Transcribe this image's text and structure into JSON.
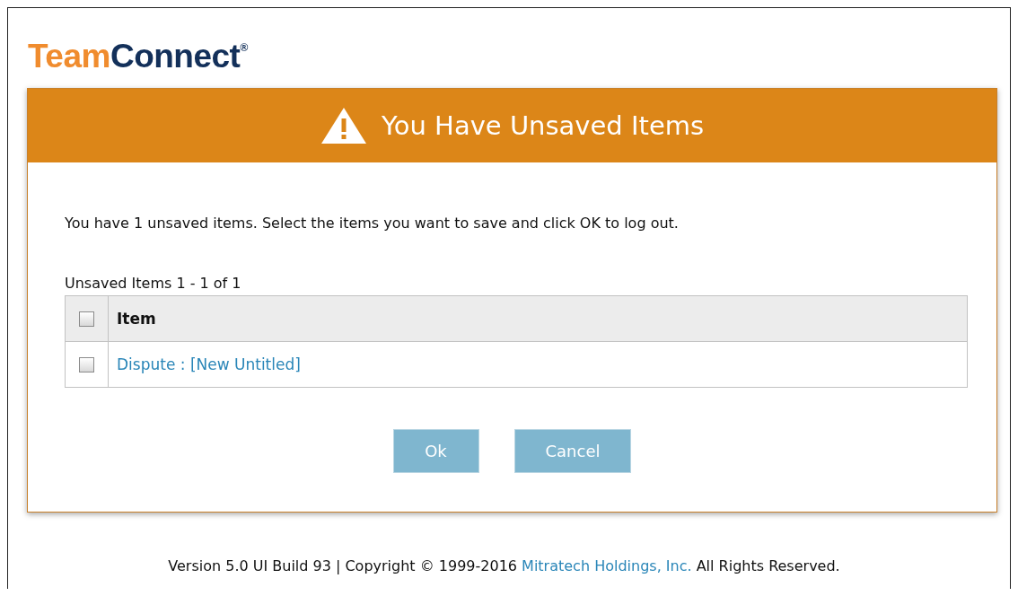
{
  "logo": {
    "first": "Team",
    "second": "Connect",
    "mark": "®"
  },
  "dialog": {
    "title": "You Have Unsaved Items",
    "message": "You have 1 unsaved items. Select the items you want to save and click OK to log out.",
    "table_caption": "Unsaved Items 1 - 1 of 1",
    "header": {
      "label": "Item",
      "checked": false
    },
    "rows": [
      {
        "label": "Dispute : [New Untitled]",
        "checked": false
      }
    ],
    "buttons": [
      "Ok",
      "Cancel"
    ]
  },
  "footer": {
    "before": "Version 5.0 UI Build 93 | Copyright © 1999-2016 ",
    "link": "Mitratech Holdings, Inc.",
    "after": " All Rights Reserved."
  }
}
